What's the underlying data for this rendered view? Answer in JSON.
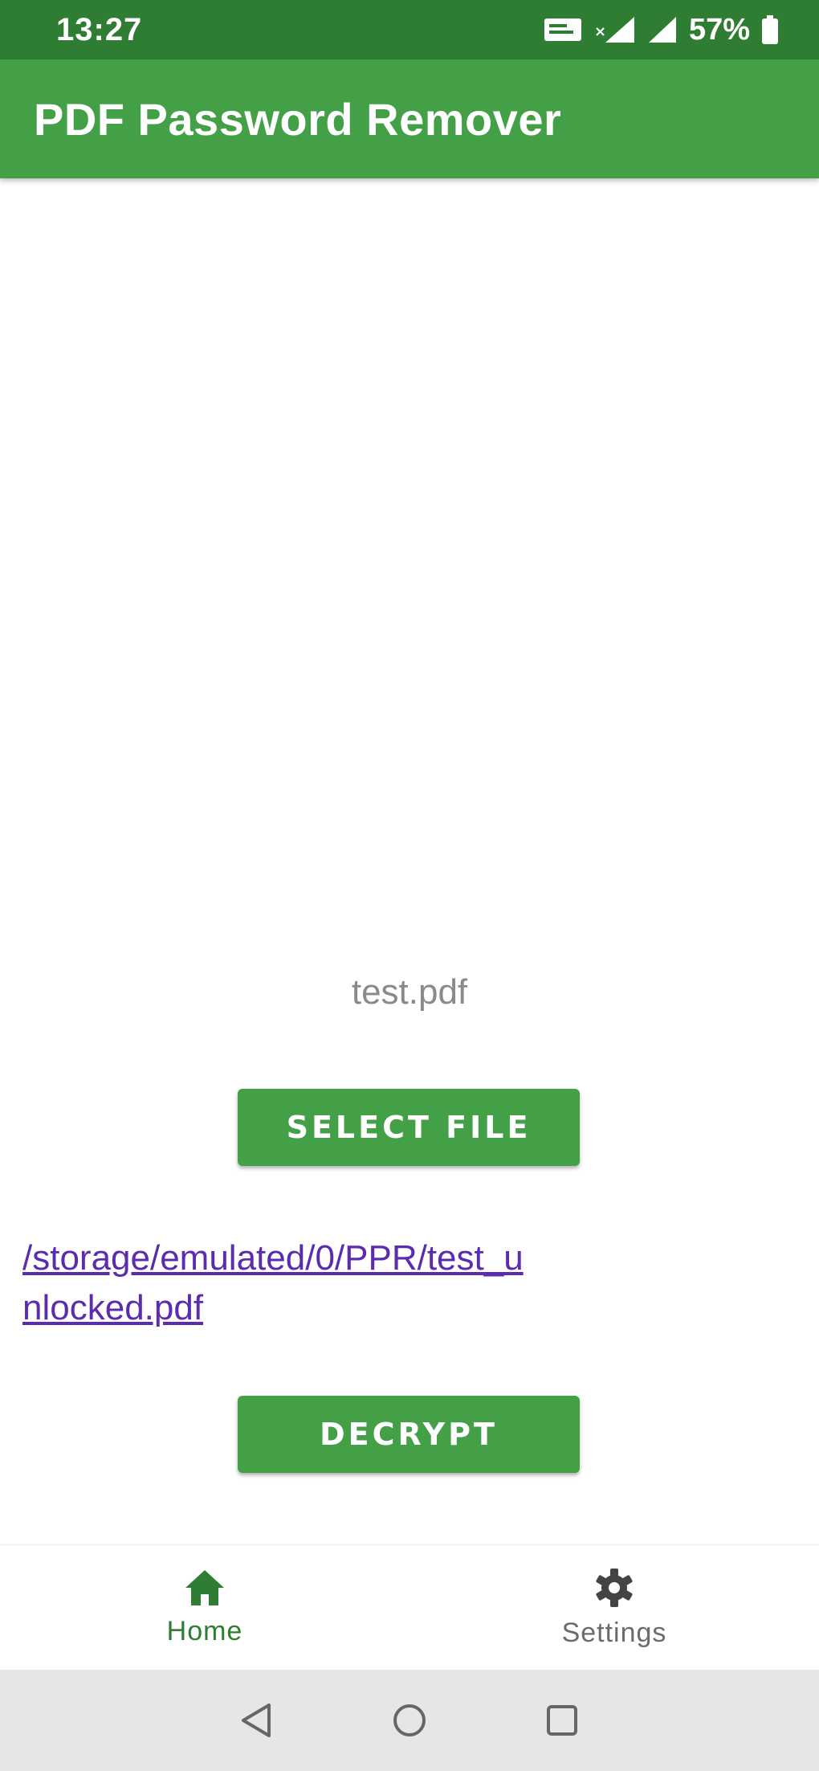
{
  "status_bar": {
    "time": "13:27",
    "battery": "57%"
  },
  "app_bar": {
    "title": "PDF Password Remover"
  },
  "main": {
    "selected_file_name": "test.pdf",
    "select_file_label": "SELECT FILE",
    "output_path": "/storage/emulated/0/PPR/test_unlocked.pdf",
    "decrypt_label": "DECRYPT"
  },
  "bottom_nav": {
    "items": [
      {
        "label": "Home",
        "icon": "home-icon",
        "active": true
      },
      {
        "label": "Settings",
        "icon": "gear-icon",
        "active": false
      }
    ]
  },
  "colors": {
    "status_bar": "#2f7d32",
    "app_bar": "#43a047",
    "button": "#43a047",
    "link": "#5b2bb0",
    "nav_active": "#2e7d32"
  }
}
